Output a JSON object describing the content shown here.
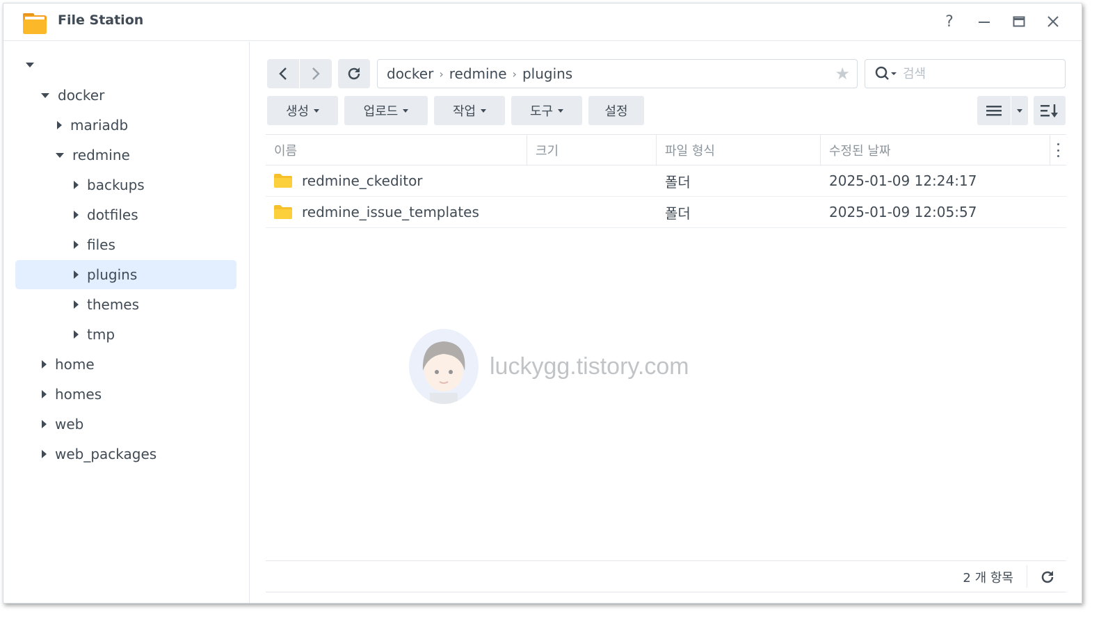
{
  "titlebar": {
    "title": "File Station",
    "help_icon": "help-icon",
    "minimize_icon": "minimize-icon",
    "maximize_icon": "maximize-icon",
    "close_icon": "close-icon"
  },
  "sidebar": {
    "items": [
      {
        "label": "",
        "expanded": true
      },
      {
        "label": "docker",
        "expanded": true
      },
      {
        "label": "mariadb",
        "expanded": false
      },
      {
        "label": "redmine",
        "expanded": true
      },
      {
        "label": "backups",
        "expanded": false
      },
      {
        "label": "dotfiles",
        "expanded": false
      },
      {
        "label": "files",
        "expanded": false
      },
      {
        "label": "plugins",
        "expanded": false,
        "selected": true
      },
      {
        "label": "themes",
        "expanded": false
      },
      {
        "label": "tmp",
        "expanded": false
      },
      {
        "label": "home",
        "expanded": false
      },
      {
        "label": "homes",
        "expanded": false
      },
      {
        "label": "web",
        "expanded": false
      },
      {
        "label": "web_packages",
        "expanded": false
      }
    ]
  },
  "path": {
    "crumbs": [
      "docker",
      "redmine",
      "plugins"
    ]
  },
  "search": {
    "placeholder": "검색"
  },
  "toolbar": {
    "create_label": "생성",
    "upload_label": "업로드",
    "action_label": "작업",
    "tools_label": "도구",
    "settings_label": "설정"
  },
  "table": {
    "headers": [
      "이름",
      "크기",
      "파일 형식",
      "수정된 날짜"
    ],
    "rows": [
      {
        "name": "redmine_ckeditor",
        "size": "",
        "type": "폴더",
        "modified": "2025-01-09 12:24:17"
      },
      {
        "name": "redmine_issue_templates",
        "size": "",
        "type": "폴더",
        "modified": "2025-01-09 12:05:57"
      }
    ]
  },
  "watermark": {
    "text": "luckygg.tistory.com"
  },
  "footer": {
    "item_count": "2 개 항목"
  },
  "colors": {
    "selected_bg": "#e3efff",
    "folder_yellow": "#f9c933",
    "button_bg": "#e8ecf1"
  }
}
